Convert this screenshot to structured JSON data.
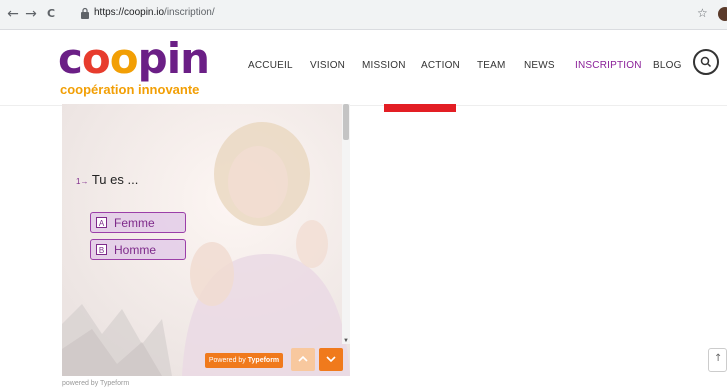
{
  "browser": {
    "back": "←",
    "forward": "→",
    "reload": "C",
    "url_host": "https://coopin.io",
    "url_path": "/inscription/",
    "star": "☆"
  },
  "site": {
    "logo": {
      "c": "c",
      "o1": "o",
      "o2": "o",
      "pin": "pin",
      "tagline": "coopération innovante"
    },
    "nav": [
      "ACCUEIL",
      "VISION",
      "MISSION",
      "ACTION",
      "TEAM",
      "NEWS",
      "INSCRIPTION",
      "BLOG"
    ],
    "active_nav": "INSCRIPTION",
    "colors": {
      "purple": "#6b1f86",
      "orange": "#f29f05",
      "red": "#e31e24",
      "typeform_orange": "#f07a1c"
    }
  },
  "form": {
    "question_number": "1→",
    "question": "Tu es ...",
    "options": [
      {
        "key": "A",
        "label": "Femme"
      },
      {
        "key": "B",
        "label": "Homme"
      }
    ],
    "powered_prefix": "Powered by",
    "powered_brand": "Typeform",
    "powered_footer": "powered by Typeform"
  },
  "back_to_top": "↑"
}
